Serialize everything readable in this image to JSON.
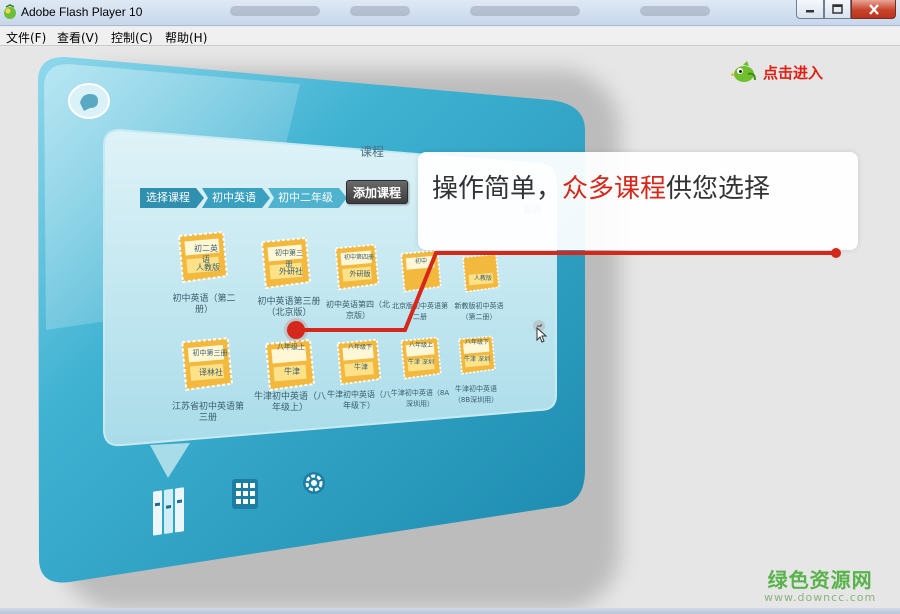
{
  "window": {
    "title": "Adobe Flash Player 10",
    "controls": {
      "minimize": "minimize",
      "maximize": "maximize",
      "close": "close"
    }
  },
  "menu": [
    {
      "label": "文件(F)"
    },
    {
      "label": "查看(V)"
    },
    {
      "label": "控制(C)"
    },
    {
      "label": "帮助(H)"
    }
  ],
  "content": {
    "enter_label": "点击进入",
    "panel_title": "课程",
    "breadcrumb": [
      "选择课程",
      "初中英语",
      "初中二年级"
    ],
    "add_course_label": "添加课程",
    "callout": {
      "prefix": "操作简单，",
      "highlight": "众多课程",
      "suffix": "供您选择"
    },
    "books_row1": [
      {
        "cover_top": "初二英语",
        "cover_bottom": "人教版",
        "label": "初中英语（第二册）"
      },
      {
        "cover_top": "初中第三册",
        "cover_bottom": "外研社",
        "label": "初中英语第三册（北京版）"
      },
      {
        "cover_top": "初中第四册",
        "cover_bottom": "外研版",
        "label": "初中英语第四（北京版）"
      },
      {
        "cover_top": "初中",
        "cover_bottom": "",
        "label": "北京版初中英语第二册"
      },
      {
        "cover_top": "",
        "cover_bottom": "人教版",
        "label": "新教版初中英语（第二册）"
      }
    ],
    "books_row2": [
      {
        "cover_top": "初中第三册",
        "cover_bottom": "译林社",
        "label": "江苏省初中英语第三册"
      },
      {
        "cover_top": "八年级上",
        "cover_bottom": "牛津",
        "label": "牛津初中英语（八年级上）"
      },
      {
        "cover_top": "八年级下",
        "cover_bottom": "牛津",
        "label": "牛津初中英语（八年级下）"
      },
      {
        "cover_top": "八年级上",
        "cover_bottom": "牛津 深圳",
        "label": "牛津初中英语（8A深圳用）"
      },
      {
        "cover_top": "八年级下",
        "cover_bottom": "牛津 深圳",
        "label": "牛津初中英语（8B深圳用）"
      }
    ],
    "cancel_label": "取消"
  },
  "watermark": {
    "main": "绿色资源网",
    "sub": "www.downcc.com"
  },
  "colors": {
    "accent": "#d5281b",
    "device_teal": "#3eaecb",
    "book_yellow": "#f7cf5c"
  },
  "icons": [
    "flash-player-icon",
    "bird-icon",
    "home-bubble-icon",
    "bookshelf-icon",
    "grid-icon",
    "settings-icon",
    "scroll-arrow-icon"
  ]
}
